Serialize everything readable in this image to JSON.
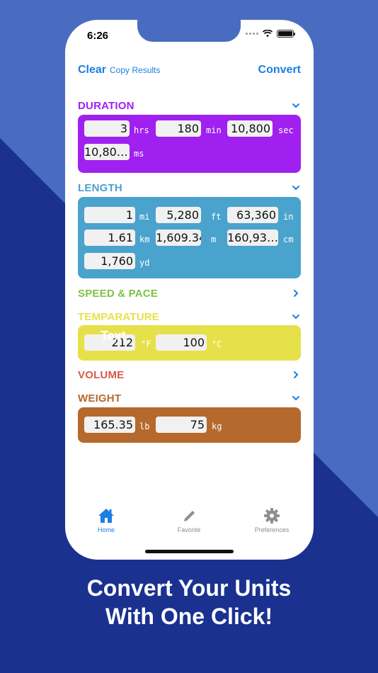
{
  "status": {
    "time": "6:26"
  },
  "nav": {
    "clear": "Clear",
    "copy": "Copy Results",
    "convert": "Convert"
  },
  "sections": {
    "duration": {
      "title": "DURATION",
      "color": "#a020f0",
      "expanded": true,
      "fields": [
        {
          "value": "3",
          "unit": "hrs"
        },
        {
          "value": "180",
          "unit": "min"
        },
        {
          "value": "10,800",
          "unit": "sec"
        },
        {
          "value": "10,80…",
          "unit": "ms"
        }
      ]
    },
    "length": {
      "title": "LENGTH",
      "color": "#4aa3cc",
      "expanded": true,
      "fields": [
        {
          "value": "1",
          "unit": "mi"
        },
        {
          "value": "5,280",
          "unit": "ft"
        },
        {
          "value": "63,360",
          "unit": "in"
        },
        {
          "value": "1.61",
          "unit": "km"
        },
        {
          "value": "1,609.34",
          "unit": "m"
        },
        {
          "value": "160,93…",
          "unit": "cm"
        },
        {
          "value": "1,760",
          "unit": "yd"
        }
      ]
    },
    "speed": {
      "title": "SPEED & PACE",
      "color": "#7dc246",
      "expanded": false
    },
    "temperature": {
      "title": "TEMPARATURE",
      "color": "#e6e14a",
      "expanded": true,
      "overlay_text": "Text",
      "fields": [
        {
          "value": "212",
          "unit": "°F"
        },
        {
          "value": "100",
          "unit": "°C"
        }
      ]
    },
    "volume": {
      "title": "VOLUME",
      "color": "#d85a45",
      "expanded": false
    },
    "weight": {
      "title": "WEIGHT",
      "color": "#b5692c",
      "expanded": true,
      "fields": [
        {
          "value": "165.35",
          "unit": "lb"
        },
        {
          "value": "75",
          "unit": "kg"
        }
      ]
    }
  },
  "tabs": [
    {
      "label": "Home",
      "icon": "house-icon",
      "active": true
    },
    {
      "label": "Favorite",
      "icon": "pencil-icon",
      "active": false
    },
    {
      "label": "Preferences",
      "icon": "gear-icon",
      "active": false
    }
  ],
  "caption": {
    "line1": "Convert Your Units",
    "line2": "With One Click!"
  },
  "colors": {
    "accent": "#1b7fe3",
    "inactive_tab": "#8e8e93"
  }
}
